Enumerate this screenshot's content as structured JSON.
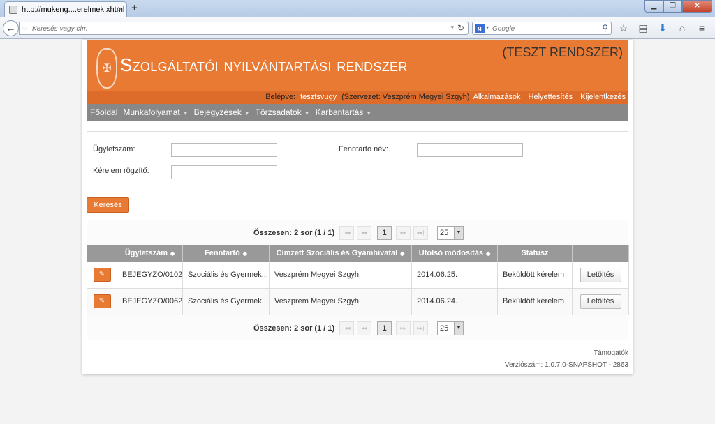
{
  "browser": {
    "tab_title": "http://mukeng....erelmek.xhtml",
    "tab_close": "×",
    "new_tab": "+",
    "url_placeholder": "Keresés vagy cím",
    "search_placeholder": "Google",
    "search_engine_letter": "g"
  },
  "header": {
    "title": "Szolgáltatói nyilvántartási rendszer",
    "test_label": "(TESZT RENDSZER)"
  },
  "userbar": {
    "logged_in_label": "Belépve:",
    "username": "tesztsvugy",
    "org": "(Szervezet: Veszprém Megyei Szgyh)",
    "links": [
      "Alkalmazások",
      "Helyettesítés",
      "Kijelentkezés"
    ]
  },
  "menu": {
    "items": [
      "Főoldal",
      "Munkafolyamat",
      "Bejegyzések",
      "Törzsadatok",
      "Karbantartás"
    ]
  },
  "search": {
    "ugyletszam_label": "Ügyletszám:",
    "fenntarto_label": "Fenntartó név:",
    "kerelem_label": "Kérelem rögzítő:",
    "ugyletszam_value": "",
    "fenntarto_value": "",
    "kerelem_value": "",
    "search_button": "Keresés"
  },
  "pager": {
    "total": "Összesen: 2 sor (1 / 1)",
    "first": "|◂◂",
    "prev": "◂◂",
    "current_page": "1",
    "next": "▸▸",
    "last": "▸▸|",
    "page_size": "25"
  },
  "table": {
    "columns": [
      "",
      "Ügyletszám",
      "Fenntartó",
      "Címzett Szociális és Gyámhivatal",
      "Utolsó módosítás",
      "Státusz",
      ""
    ],
    "rows": [
      {
        "ugyletszam": "BEJEGYZO/0102",
        "fenntarto": "Szociális és Gyermek...",
        "cimzett": "Veszprém Megyei Szgyh",
        "modositas": "2014.06.25.",
        "statusz": "Beküldött kérelem",
        "action": "Letöltés"
      },
      {
        "ugyletszam": "BEJEGYZO/0062",
        "fenntarto": "Szociális és Gyermek...",
        "cimzett": "Veszprém Megyei Szgyh",
        "modositas": "2014.06.24.",
        "statusz": "Beküldött kérelem",
        "action": "Letöltés"
      }
    ]
  },
  "footer": {
    "supporters": "Támogatók",
    "version": "Verziószám: 1.0.7.0-SNAPSHOT - 2863"
  },
  "colors": {
    "brand": "#e87a33",
    "userbar": "#dd6c2a",
    "menubar": "#888888",
    "table_header": "#999999"
  }
}
